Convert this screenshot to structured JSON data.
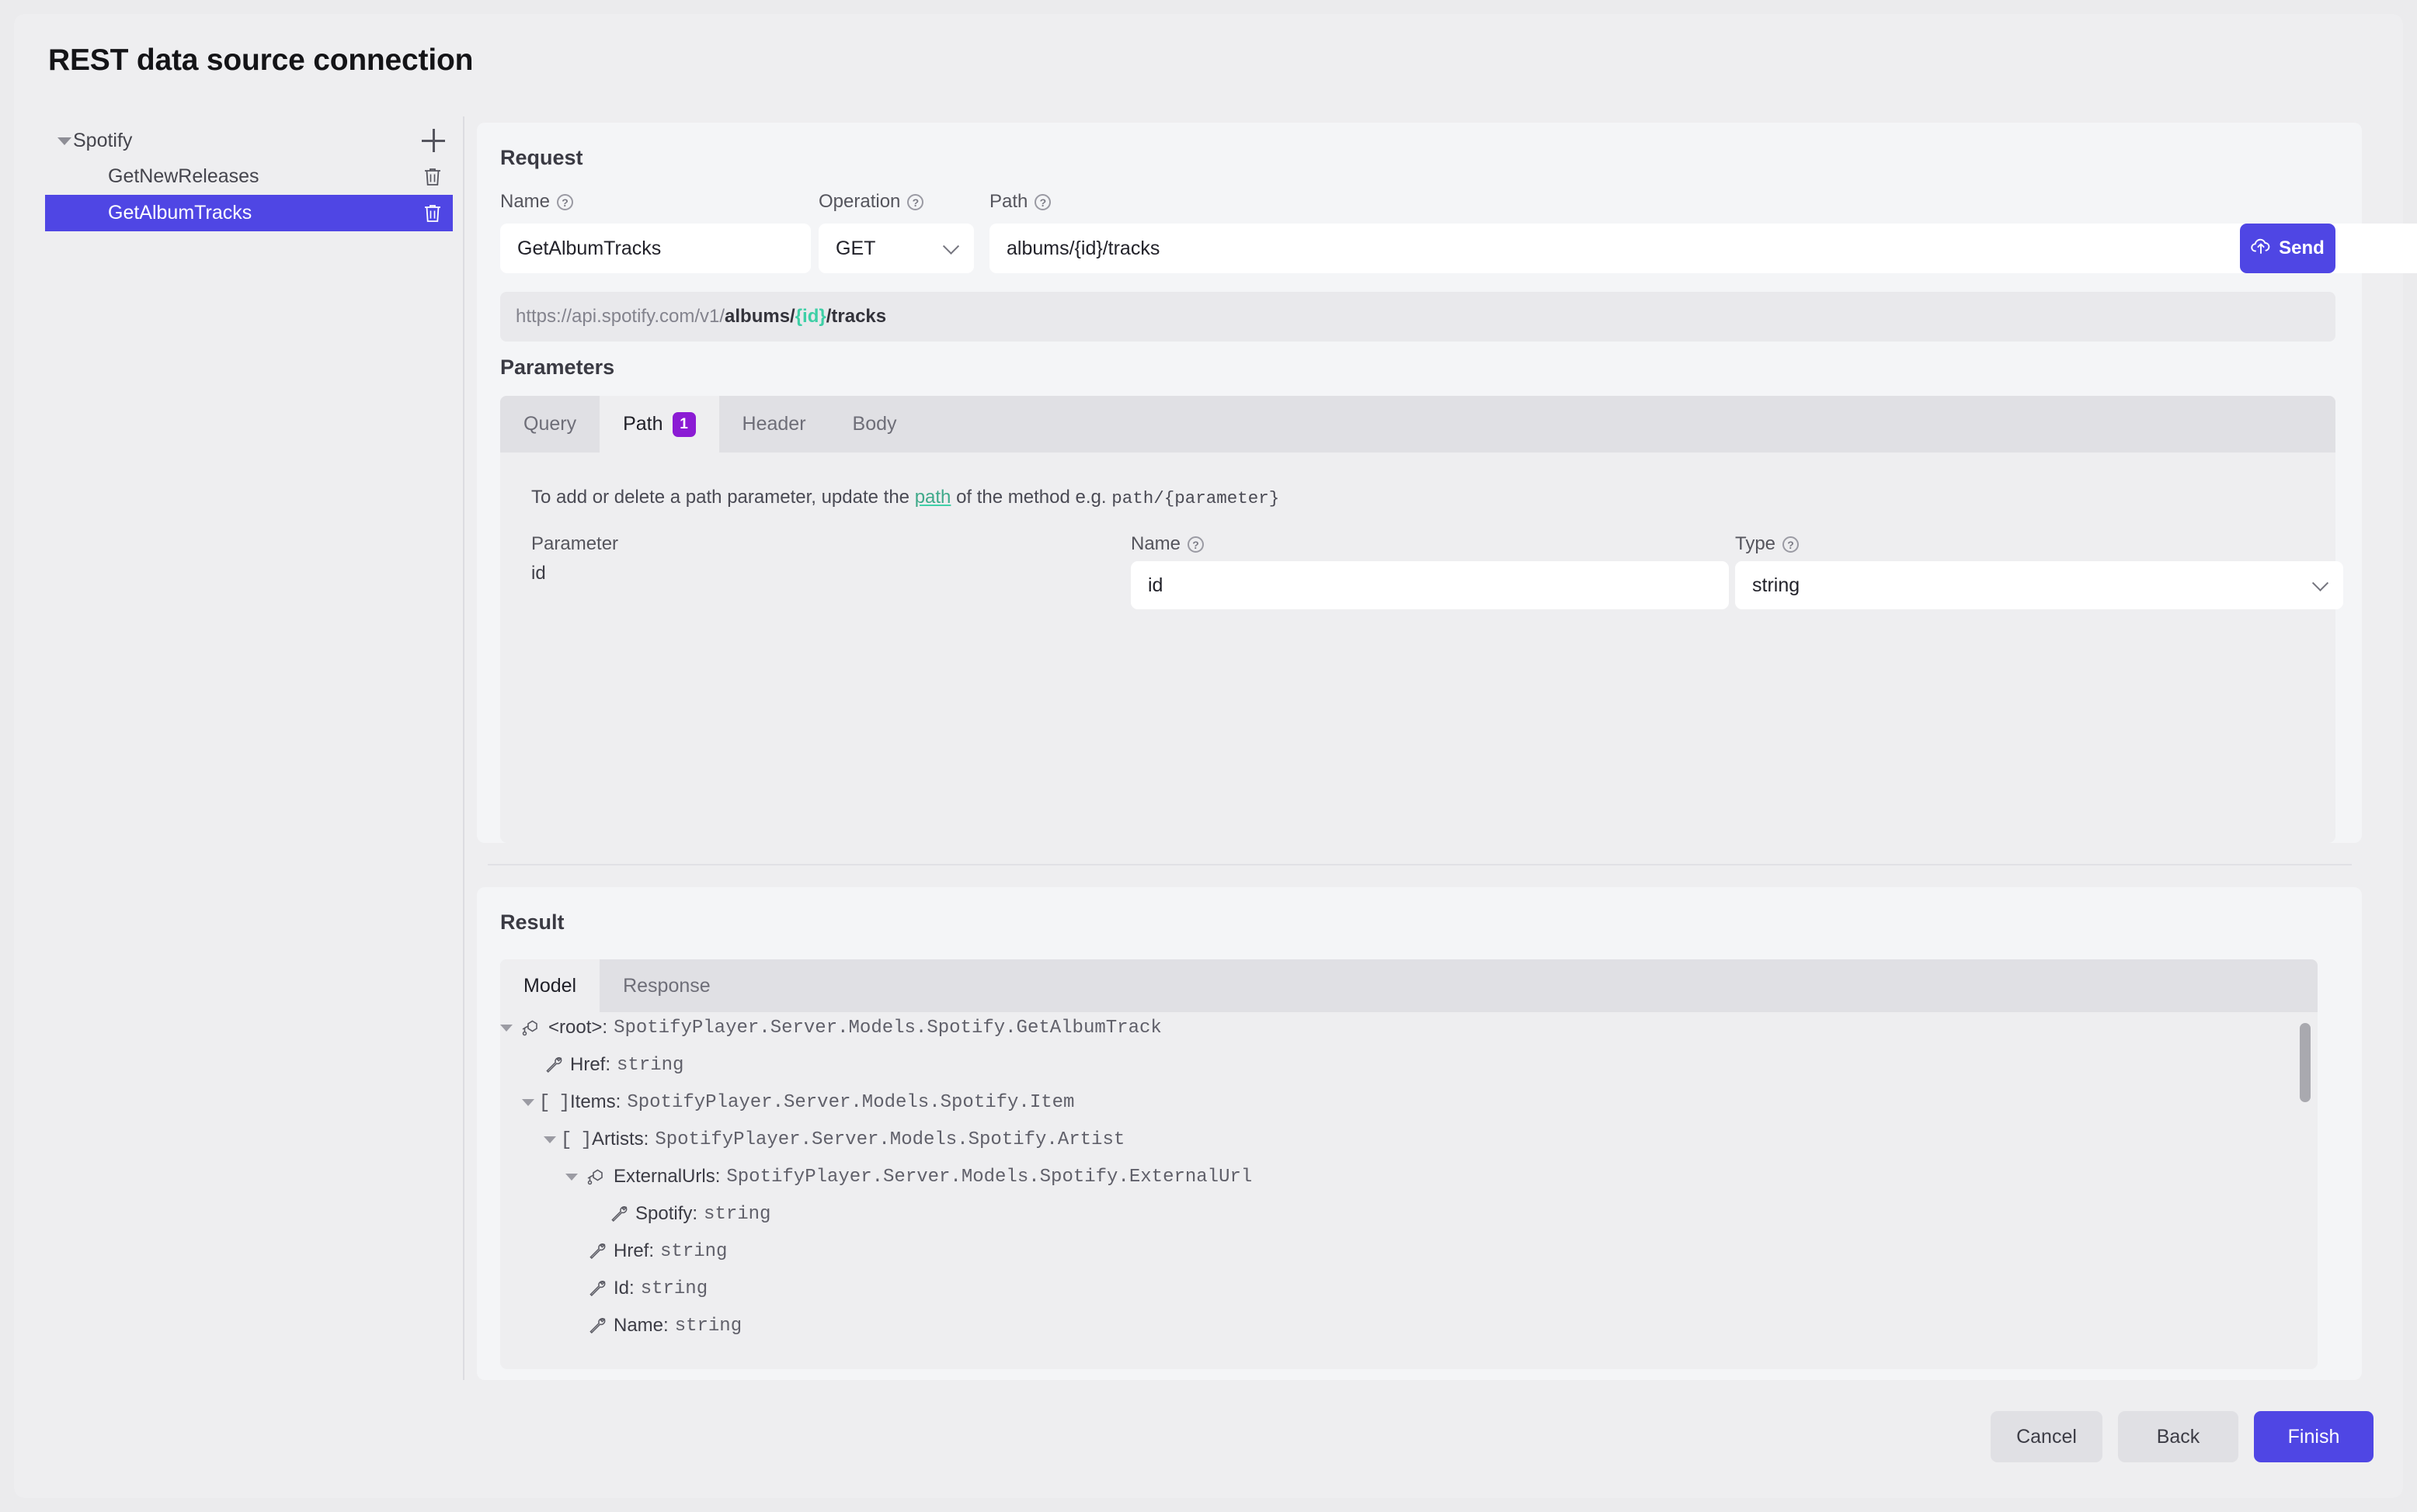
{
  "page": {
    "title": "REST data source connection"
  },
  "sidebar": {
    "root": {
      "label": "Spotify",
      "add_icon": "plus-icon",
      "caret_icon": "caret-down-icon"
    },
    "items": [
      {
        "label": "GetNewReleases",
        "selected": false,
        "delete_icon": "trash-icon"
      },
      {
        "label": "GetAlbumTracks",
        "selected": true,
        "delete_icon": "trash-icon"
      }
    ]
  },
  "request": {
    "heading": "Request",
    "name_label": "Name",
    "name_value": "GetAlbumTracks",
    "operation_label": "Operation",
    "operation_value": "GET",
    "path_label": "Path",
    "path_value": "albums/{id}/tracks",
    "send_label": "Send",
    "send_icon": "cloud-upload-icon",
    "url_preview": {
      "base": "https://api.spotify.com/v1/",
      "segment1": "albums/",
      "token": "{id}",
      "segment2": "/tracks"
    }
  },
  "parameters": {
    "heading": "Parameters",
    "tabs": [
      {
        "label": "Query",
        "active": false,
        "badge": null
      },
      {
        "label": "Path",
        "active": true,
        "badge": "1"
      },
      {
        "label": "Header",
        "active": false,
        "badge": null
      },
      {
        "label": "Body",
        "active": false,
        "badge": null
      }
    ],
    "hint_prefix": "To add or delete a path parameter, update the ",
    "hint_link": "path",
    "hint_middle": " of the method e.g. ",
    "hint_mono": "path/{parameter}",
    "col_parameter_label": "Parameter",
    "col_name_label": "Name",
    "col_type_label": "Type",
    "row": {
      "parameter": "id",
      "name_value": "id",
      "type_value": "string"
    }
  },
  "result": {
    "heading": "Result",
    "tabs": [
      {
        "label": "Model",
        "active": true
      },
      {
        "label": "Response",
        "active": false
      }
    ],
    "tree": [
      {
        "indent": 0,
        "caret": true,
        "icon": "class-icon",
        "name": "<root>:",
        "type": "SpotifyPlayer.Server.Models.Spotify.GetAlbumTrack"
      },
      {
        "indent": 1,
        "caret": false,
        "icon": "property-icon",
        "name": "Href:",
        "type": "string"
      },
      {
        "indent": 1,
        "caret": true,
        "icon": "array-icon",
        "name": "Items:",
        "type": "SpotifyPlayer.Server.Models.Spotify.Item"
      },
      {
        "indent": 2,
        "caret": true,
        "icon": "array-icon",
        "name": "Artists:",
        "type": "SpotifyPlayer.Server.Models.Spotify.Artist"
      },
      {
        "indent": 3,
        "caret": true,
        "icon": "class-icon",
        "name": "ExternalUrls:",
        "type": "SpotifyPlayer.Server.Models.Spotify.ExternalUrl"
      },
      {
        "indent": 4,
        "caret": false,
        "icon": "property-icon",
        "name": "Spotify:",
        "type": "string"
      },
      {
        "indent": 3,
        "caret": false,
        "icon": "property-icon",
        "name": "Href:",
        "type": "string"
      },
      {
        "indent": 3,
        "caret": false,
        "icon": "property-icon",
        "name": "Id:",
        "type": "string"
      },
      {
        "indent": 3,
        "caret": false,
        "icon": "property-icon",
        "name": "Name:",
        "type": "string"
      }
    ]
  },
  "footer": {
    "cancel_label": "Cancel",
    "back_label": "Back",
    "finish_label": "Finish"
  },
  "colors": {
    "accent": "#4f46e4",
    "badge": "#8b1bd4",
    "token_teal": "#3fcfa6",
    "page_bg": "#eeeef0",
    "panel_bg": "#f4f5f7"
  }
}
